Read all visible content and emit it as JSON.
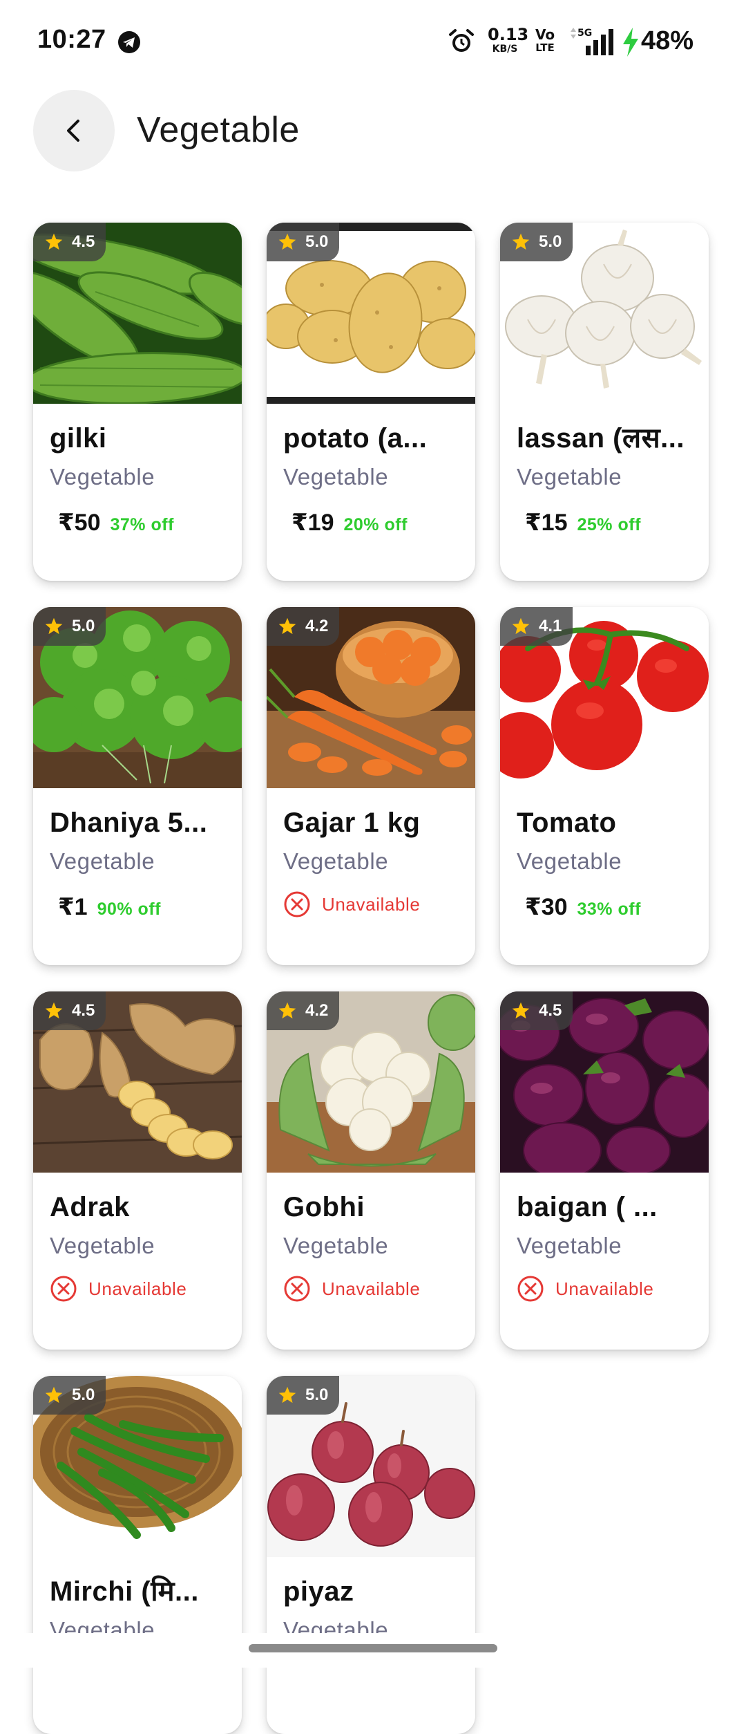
{
  "status_bar": {
    "time": "10:27",
    "net_speed": "0.13",
    "net_unit": "KB/S",
    "volte_top": "Vo",
    "volte_bottom": "LTE",
    "network": "5G",
    "battery": "48%"
  },
  "header": {
    "title": "Vegetable"
  },
  "colors": {
    "discount": "#2ecc2e",
    "unavailable": "#e53935",
    "category_text": "#6e6e86",
    "star": "#ffc107"
  },
  "products": [
    {
      "name": "gilki",
      "category": "Vegetable",
      "rating": "4.5",
      "price": "₹50",
      "discount": "37% off",
      "available": true,
      "image_icon": "sponge-gourd-image"
    },
    {
      "name": "potato (a...",
      "category": "Vegetable",
      "rating": "5.0",
      "price": "₹19",
      "discount": "20% off",
      "available": true,
      "image_icon": "potato-image"
    },
    {
      "name": "lassan (लस...",
      "category": "Vegetable",
      "rating": "5.0",
      "price": "₹15",
      "discount": "25% off",
      "available": true,
      "image_icon": "garlic-image"
    },
    {
      "name": "Dhaniya 5...",
      "category": "Vegetable",
      "rating": "5.0",
      "price": "₹1",
      "discount": "90% off",
      "available": true,
      "image_icon": "coriander-image"
    },
    {
      "name": "Gajar 1 kg",
      "category": "Vegetable",
      "rating": "4.2",
      "unavailable_label": "Unavailable",
      "available": false,
      "image_icon": "carrot-image"
    },
    {
      "name": "Tomato",
      "category": "Vegetable",
      "rating": "4.1",
      "price": "₹30",
      "discount": "33% off",
      "available": true,
      "image_icon": "tomato-image"
    },
    {
      "name": "Adrak",
      "category": "Vegetable",
      "rating": "4.5",
      "unavailable_label": "Unavailable",
      "available": false,
      "image_icon": "ginger-image"
    },
    {
      "name": "Gobhi",
      "category": "Vegetable",
      "rating": "4.2",
      "unavailable_label": "Unavailable",
      "available": false,
      "image_icon": "cauliflower-image"
    },
    {
      "name": "baigan ( ...",
      "category": "Vegetable",
      "rating": "4.5",
      "unavailable_label": "Unavailable",
      "available": false,
      "image_icon": "eggplant-image"
    },
    {
      "name": "Mirchi (मि...",
      "category": "Vegetable",
      "rating": "5.0",
      "available": true,
      "image_icon": "chili-image"
    },
    {
      "name": "piyaz",
      "category": "Vegetable",
      "rating": "5.0",
      "available": true,
      "image_icon": "onion-image"
    }
  ]
}
